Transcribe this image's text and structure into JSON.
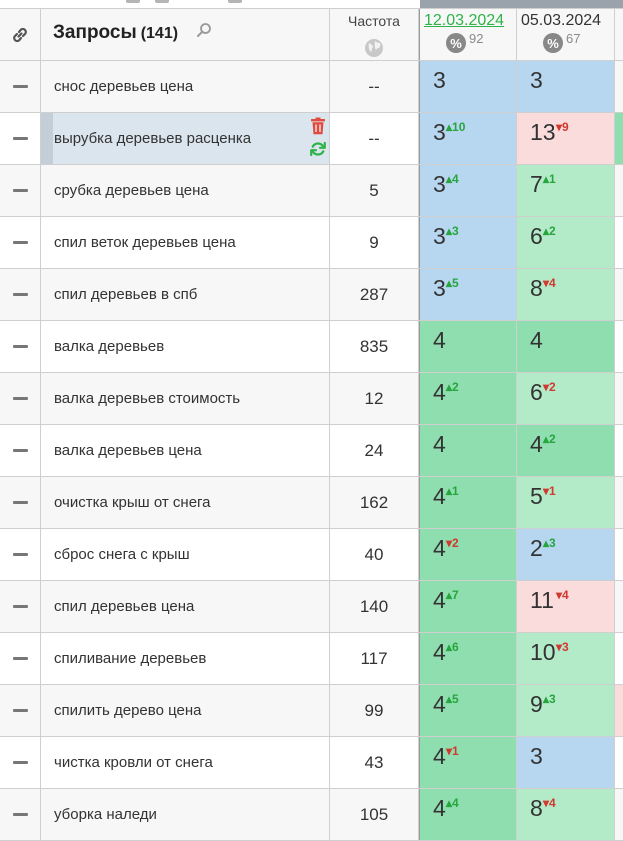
{
  "header": {
    "link_icon": "link-icon",
    "title": "Запросы",
    "count": "(141)",
    "search_icon": "search-icon",
    "freq_label": "Частота",
    "globe_icon": "globe-icon",
    "dates": [
      {
        "label": "12.03.2024",
        "pct_symbol": "%",
        "pct": "92",
        "active": true
      },
      {
        "label": "05.03.2024",
        "pct_symbol": "%",
        "pct": "67",
        "active": false
      }
    ]
  },
  "rows": [
    {
      "query": "снос деревьев цена",
      "freq": "--",
      "p1": "3",
      "d1": "",
      "d1dir": "",
      "c1": "blue",
      "p2": "3",
      "d2": "",
      "d2dir": "",
      "c2": "blue",
      "c3": "",
      "selected": false
    },
    {
      "query": "вырубка деревьев расценка",
      "freq": "--",
      "p1": "3",
      "d1": "10",
      "d1dir": "up",
      "c1": "blue",
      "p2": "13",
      "d2": "9",
      "d2dir": "down",
      "c2": "pink",
      "c3": "green",
      "selected": true
    },
    {
      "query": "срубка деревьев цена",
      "freq": "5",
      "p1": "3",
      "d1": "4",
      "d1dir": "up",
      "c1": "blue",
      "p2": "7",
      "d2": "1",
      "d2dir": "up",
      "c2": "lgreen",
      "c3": "",
      "selected": false
    },
    {
      "query": "спил веток деревьев цена",
      "freq": "9",
      "p1": "3",
      "d1": "3",
      "d1dir": "up",
      "c1": "blue",
      "p2": "6",
      "d2": "2",
      "d2dir": "up",
      "c2": "lgreen",
      "c3": "",
      "selected": false
    },
    {
      "query": "спил деревьев в спб",
      "freq": "287",
      "p1": "3",
      "d1": "5",
      "d1dir": "up",
      "c1": "blue",
      "p2": "8",
      "d2": "4",
      "d2dir": "down",
      "c2": "lgreen",
      "c3": "",
      "selected": false
    },
    {
      "query": "валка деревьев",
      "freq": "835",
      "p1": "4",
      "d1": "",
      "d1dir": "",
      "c1": "green",
      "p2": "4",
      "d2": "",
      "d2dir": "",
      "c2": "green",
      "c3": "",
      "selected": false
    },
    {
      "query": "валка деревьев стоимость",
      "freq": "12",
      "p1": "4",
      "d1": "2",
      "d1dir": "up",
      "c1": "green",
      "p2": "6",
      "d2": "2",
      "d2dir": "down",
      "c2": "lgreen",
      "c3": "",
      "selected": false
    },
    {
      "query": "валка деревьев цена",
      "freq": "24",
      "p1": "4",
      "d1": "",
      "d1dir": "",
      "c1": "green",
      "p2": "4",
      "d2": "2",
      "d2dir": "up",
      "c2": "green",
      "c3": "",
      "selected": false
    },
    {
      "query": "очистка крыш от снега",
      "freq": "162",
      "p1": "4",
      "d1": "1",
      "d1dir": "up",
      "c1": "green",
      "p2": "5",
      "d2": "1",
      "d2dir": "down",
      "c2": "lgreen",
      "c3": "",
      "selected": false
    },
    {
      "query": "сброс снега с крыш",
      "freq": "40",
      "p1": "4",
      "d1": "2",
      "d1dir": "down",
      "c1": "green",
      "p2": "2",
      "d2": "3",
      "d2dir": "up",
      "c2": "blue",
      "c3": "",
      "selected": false
    },
    {
      "query": "спил деревьев цена",
      "freq": "140",
      "p1": "4",
      "d1": "7",
      "d1dir": "up",
      "c1": "green",
      "p2": "11",
      "d2": "4",
      "d2dir": "down",
      "c2": "pink",
      "c3": "",
      "selected": false
    },
    {
      "query": "спиливание деревьев",
      "freq": "117",
      "p1": "4",
      "d1": "6",
      "d1dir": "up",
      "c1": "green",
      "p2": "10",
      "d2": "3",
      "d2dir": "down",
      "c2": "lgreen",
      "c3": "",
      "selected": false
    },
    {
      "query": "спилить дерево цена",
      "freq": "99",
      "p1": "4",
      "d1": "5",
      "d1dir": "up",
      "c1": "green",
      "p2": "9",
      "d2": "3",
      "d2dir": "up",
      "c2": "lgreen",
      "c3": "pink",
      "selected": false
    },
    {
      "query": "чистка кровли от снега",
      "freq": "43",
      "p1": "4",
      "d1": "1",
      "d1dir": "down",
      "c1": "green",
      "p2": "3",
      "d2": "",
      "d2dir": "",
      "c2": "blue",
      "c3": "",
      "selected": false
    },
    {
      "query": "уборка наледи",
      "freq": "105",
      "p1": "4",
      "d1": "4",
      "d1dir": "up",
      "c1": "green",
      "p2": "8",
      "d2": "4",
      "d2dir": "down",
      "c2": "lgreen",
      "c3": "",
      "selected": false
    }
  ],
  "row_tools": {
    "delete_icon": "trash-icon",
    "refresh_icon": "refresh-icon"
  },
  "colors": {
    "blue": "#b7d7f0",
    "green": "#8fdeb0",
    "lgreen": "#b3ebc9",
    "pink": "#fbdcdc",
    "accent_green": "#2fb24a",
    "delta_up": "#27a53e",
    "delta_down": "#d0392f",
    "trash": "#e14b3f"
  }
}
